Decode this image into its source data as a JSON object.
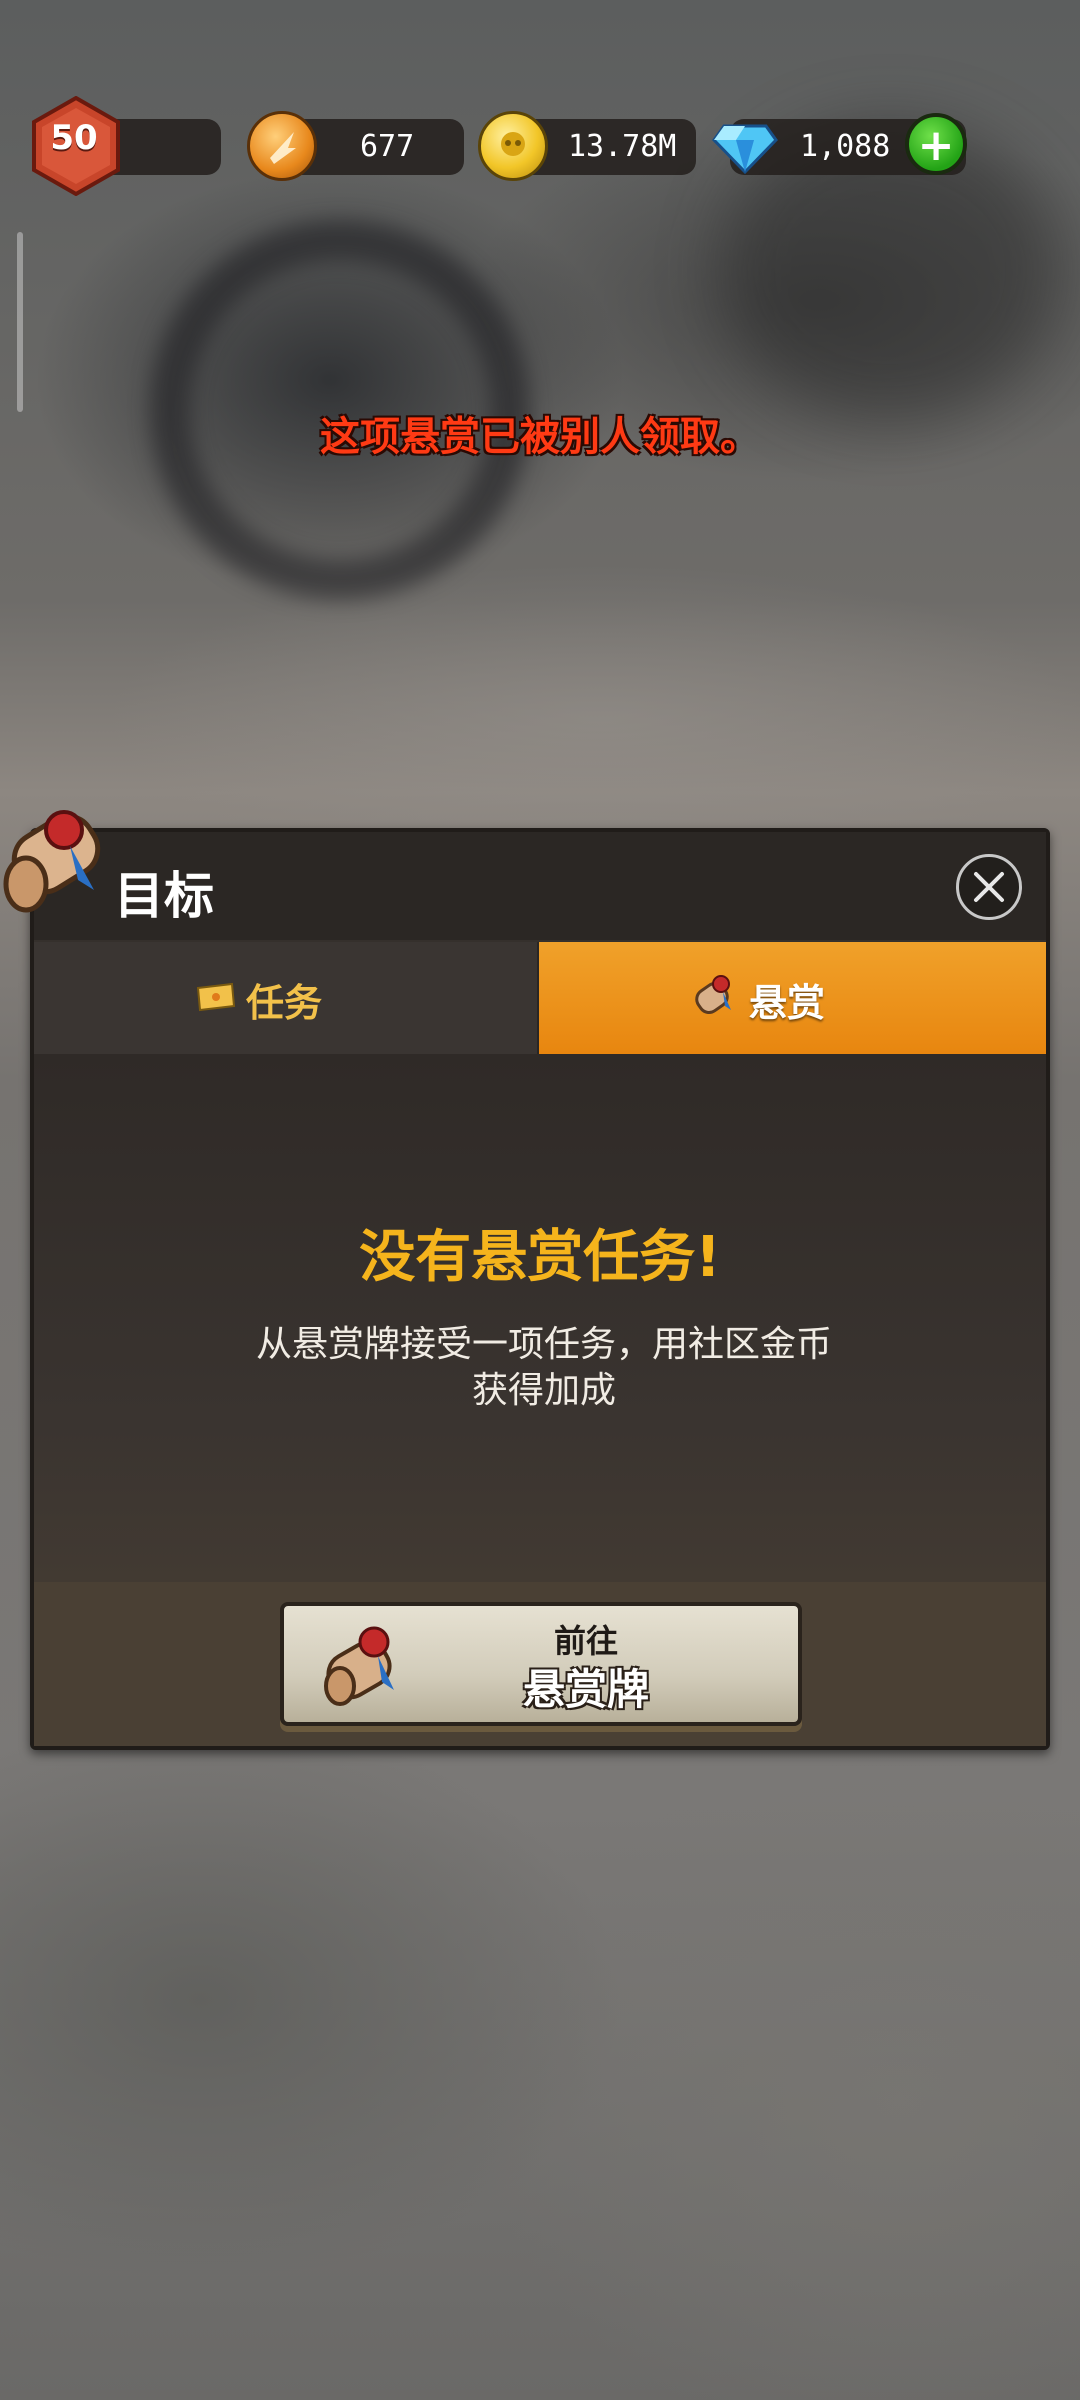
{
  "hud": {
    "level": "50",
    "energy": "677",
    "gold": "13.78M",
    "gems": "1,088",
    "add_label": "+"
  },
  "toast": "这项悬赏已被别人领取。",
  "panel": {
    "title": "目标",
    "tabs": [
      {
        "label": "任务",
        "icon": "ticket-icon",
        "active": false
      },
      {
        "label": "悬赏",
        "icon": "scroll-icon",
        "active": true
      }
    ],
    "empty_title": "没有悬赏任务!",
    "empty_desc": "从悬赏牌接受一项任务，用社区金币获得加成",
    "button": {
      "small": "前往",
      "big": "悬赏牌",
      "icon": "scroll-icon"
    }
  },
  "colors": {
    "accent_orange": "#e8860f",
    "title_yellow": "#f5b41c",
    "toast_red": "#ff3a14",
    "plus_green": "#23a316"
  }
}
